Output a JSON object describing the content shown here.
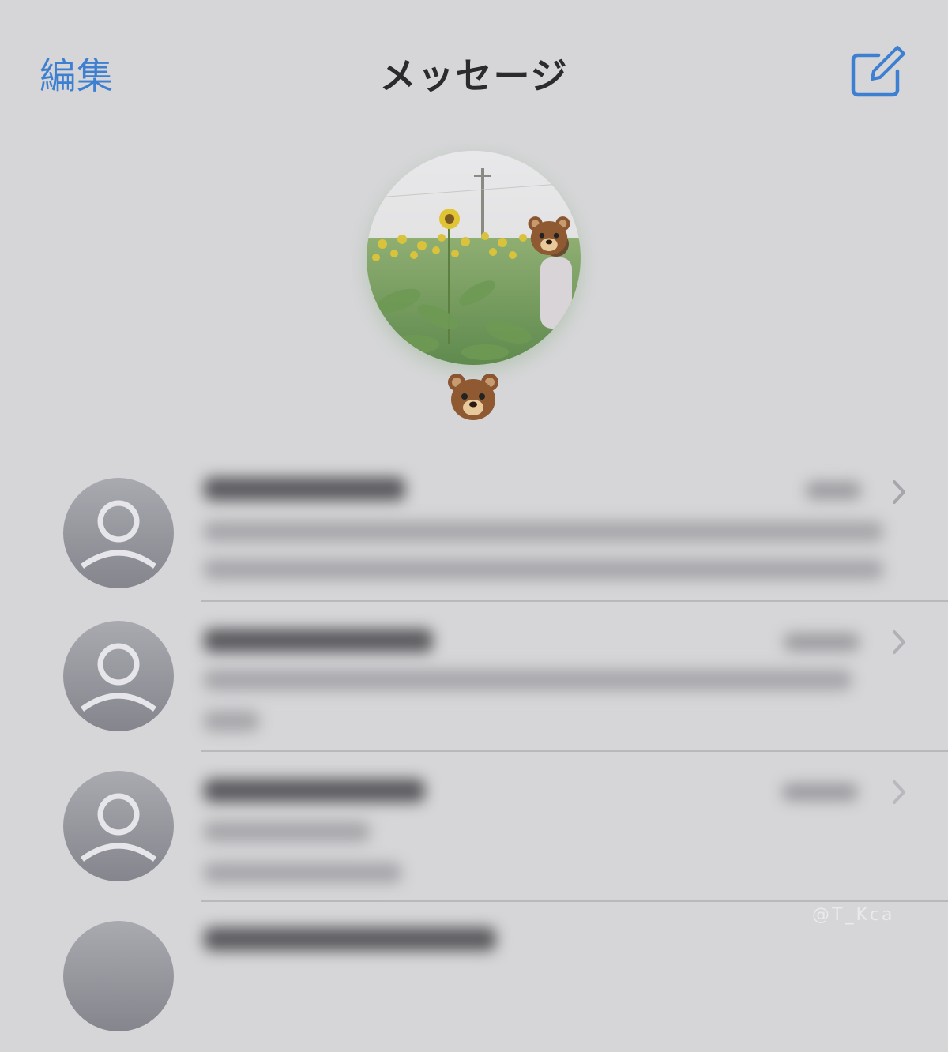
{
  "nav": {
    "edit_label": "編集",
    "title": "メッセージ",
    "compose_icon": "compose-icon"
  },
  "pinned": {
    "name_emoji": "🐻",
    "sticker_emoji": "🐻"
  },
  "conversations": [
    {
      "name": "",
      "time": "",
      "preview": "",
      "avatar_icon": "person-placeholder-icon"
    },
    {
      "name": "",
      "time": "",
      "preview": "",
      "avatar_icon": "person-placeholder-icon"
    },
    {
      "name": "",
      "time": "",
      "preview": "",
      "avatar_icon": "person-placeholder-icon"
    },
    {
      "name": "",
      "time": "",
      "preview": "",
      "avatar_icon": "person-placeholder-icon"
    }
  ],
  "watermark": "@T_Kca",
  "colors": {
    "background": "#d6d6d8",
    "accent": "#3d7fd0",
    "avatar_gray": "#9c9ca3"
  }
}
